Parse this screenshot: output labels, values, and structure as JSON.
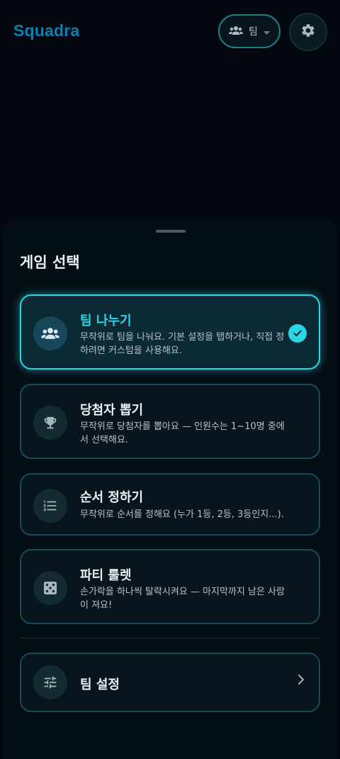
{
  "app": {
    "title": "Squadra"
  },
  "header": {
    "team_selector_label": "팀"
  },
  "sheet": {
    "title": "게임 선택"
  },
  "games": [
    {
      "title": "팀 나누기",
      "description": "무작위로 팀을 나눠요. 기본 설정을 탭하거나, 직접 정하려면 커스텀을 사용해요.",
      "selected": true,
      "icon": "groups-icon"
    },
    {
      "title": "당첨자 뽑기",
      "description": "무작위로 당첨자를 뽑아요 — 인원수는 1~10명 중에서 선택해요.",
      "selected": false,
      "icon": "trophy-icon"
    },
    {
      "title": "순서 정하기",
      "description": "무작위로 순서를 정해요 (누가 1등, 2등, 3등인지...).",
      "selected": false,
      "icon": "numbered-list-icon"
    },
    {
      "title": "파티 룰렛",
      "description": "손가락을 하나씩 탈락시켜요 — 마지막까지 남은 사람이 져요!",
      "selected": false,
      "icon": "dice-icon"
    }
  ],
  "team_settings": {
    "label": "팀 설정",
    "icon": "tune-icon"
  },
  "colors": {
    "accent": "#2ad5e6",
    "logo": "#0f7fb3",
    "background": "#02080d",
    "card_border": "#164b58",
    "card_bg": "#07161e"
  }
}
